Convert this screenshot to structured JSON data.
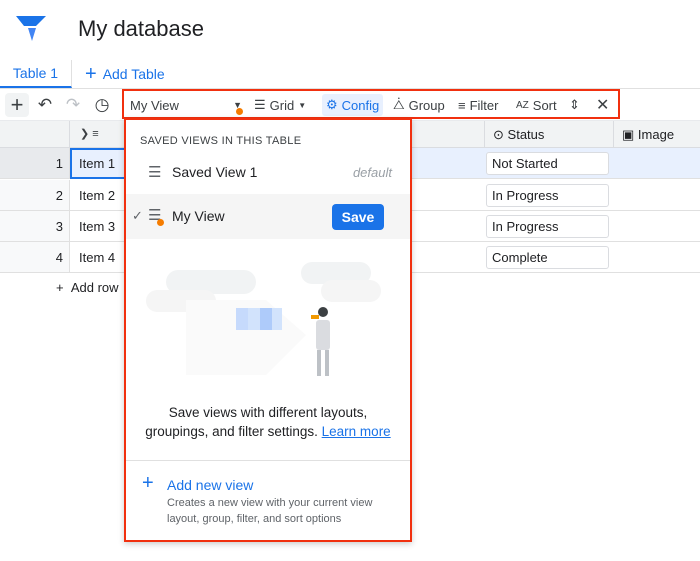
{
  "app": {
    "title": "My database"
  },
  "tabs": [
    {
      "label": "Table 1"
    },
    {
      "label": "Add Table"
    }
  ],
  "toolbar": {
    "view_select": "My View",
    "grid": "Grid",
    "config": "Config",
    "group": "Group",
    "filter": "Filter",
    "sort": "Sort"
  },
  "columns": [
    {
      "label": "Status"
    },
    {
      "label": "Image"
    }
  ],
  "rows": [
    {
      "num": "1",
      "name": "Item 1",
      "status": "Not Started"
    },
    {
      "num": "2",
      "name": "Item 2",
      "status": "In Progress"
    },
    {
      "num": "3",
      "name": "Item 3",
      "status": "In Progress"
    },
    {
      "num": "4",
      "name": "Item 4",
      "status": "Complete"
    }
  ],
  "add_row": "Add row",
  "popup": {
    "heading": "SAVED VIEWS IN THIS TABLE",
    "views": [
      {
        "label": "Saved View 1",
        "badge": "default"
      },
      {
        "label": "My View",
        "button": "Save"
      }
    ],
    "empty_text": "Save views with different layouts, groupings, and filter settings.",
    "learn_more": "Learn more",
    "add_view": "Add new view",
    "add_view_desc": "Creates a new view with your current view layout, group, filter, and sort options"
  },
  "colors": {
    "accent": "#1a73e8",
    "highlight": "#f1300f",
    "unsaved_dot": "#f57c00"
  }
}
